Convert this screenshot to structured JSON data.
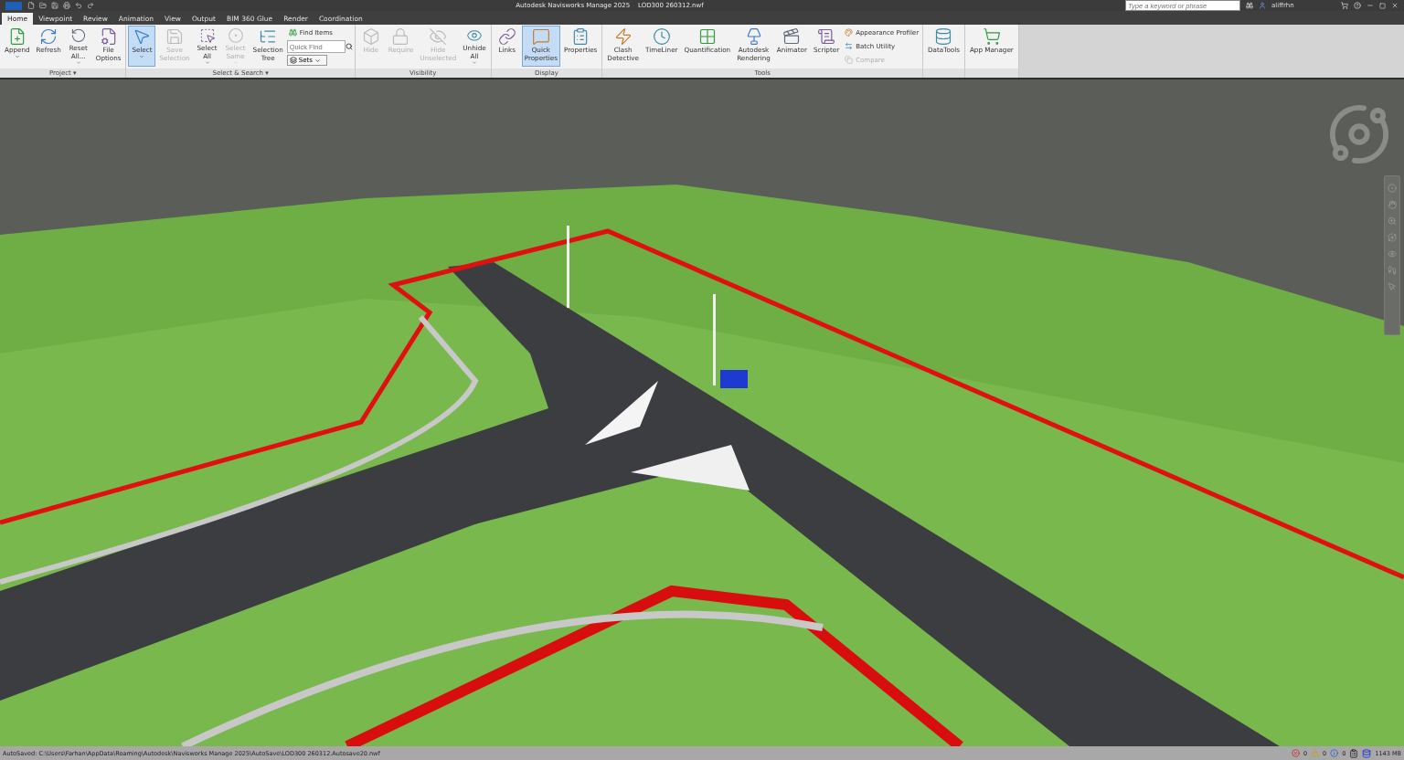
{
  "title_bar": {
    "app": "Autodesk Navisworks Manage 2025",
    "file": "LOD300 260312.nwf",
    "search_placeholder": "Type a keyword or phrase",
    "user": "aliffrhn"
  },
  "tabs": [
    {
      "label": "Home",
      "selected": true
    },
    {
      "label": "Viewpoint",
      "selected": false
    },
    {
      "label": "Review",
      "selected": false
    },
    {
      "label": "Animation",
      "selected": false
    },
    {
      "label": "View",
      "selected": false
    },
    {
      "label": "Output",
      "selected": false
    },
    {
      "label": "BIM 360 Glue",
      "selected": false
    },
    {
      "label": "Render",
      "selected": false
    },
    {
      "label": "Coordination",
      "selected": false
    }
  ],
  "panels": [
    {
      "title": "Project ▾",
      "items": [
        {
          "kind": "large",
          "label": "Append",
          "disabled": false,
          "selected": false,
          "has_menu": true
        },
        {
          "kind": "large",
          "label": "Refresh",
          "disabled": false,
          "selected": false,
          "has_menu": false
        },
        {
          "kind": "large",
          "label": "Reset\nAll...",
          "disabled": false,
          "selected": false,
          "has_menu": true
        },
        {
          "kind": "large",
          "label": "File\nOptions",
          "disabled": false,
          "selected": false,
          "has_menu": false
        }
      ]
    },
    {
      "title": "Select & Search ▾",
      "items": [
        {
          "kind": "large",
          "label": "Select",
          "disabled": false,
          "selected": true,
          "has_menu": true
        },
        {
          "kind": "large",
          "label": "Save\nSelection",
          "disabled": true,
          "selected": false,
          "has_menu": false
        },
        {
          "kind": "large",
          "label": "Select\nAll",
          "disabled": false,
          "selected": false,
          "has_menu": true
        },
        {
          "kind": "large",
          "label": "Select\nSame",
          "disabled": true,
          "selected": false,
          "has_menu": true
        },
        {
          "kind": "large",
          "label": "Selection\nTree",
          "disabled": false,
          "selected": false,
          "has_menu": false
        },
        {
          "kind": "small",
          "label": "Find Items",
          "disabled": false
        },
        {
          "kind": "field",
          "placeholder": "Quick Find"
        },
        {
          "kind": "dropdown",
          "label": "Sets"
        }
      ]
    },
    {
      "title": "Visibility",
      "items": [
        {
          "kind": "large",
          "label": "Hide",
          "disabled": true,
          "selected": false,
          "has_menu": false
        },
        {
          "kind": "large",
          "label": "Require",
          "disabled": true,
          "selected": false,
          "has_menu": false
        },
        {
          "kind": "large",
          "label": "Hide\nUnselected",
          "disabled": true,
          "selected": false,
          "has_menu": false
        },
        {
          "kind": "large",
          "label": "Unhide\nAll",
          "disabled": false,
          "selected": false,
          "has_menu": true
        }
      ]
    },
    {
      "title": "Display",
      "items": [
        {
          "kind": "large",
          "label": "Links",
          "disabled": false,
          "selected": false,
          "has_menu": false
        },
        {
          "kind": "large",
          "label": "Quick\nProperties",
          "disabled": false,
          "selected": true,
          "has_menu": false
        },
        {
          "kind": "large",
          "label": "Properties",
          "disabled": false,
          "selected": false,
          "has_menu": false
        }
      ]
    },
    {
      "title": "Tools",
      "items": [
        {
          "kind": "large",
          "label": "Clash\nDetective",
          "disabled": false,
          "selected": false,
          "has_menu": false
        },
        {
          "kind": "large",
          "label": "TimeLiner",
          "disabled": false,
          "selected": false,
          "has_menu": false
        },
        {
          "kind": "large",
          "label": "Quantification",
          "disabled": false,
          "selected": false,
          "has_menu": false
        },
        {
          "kind": "large",
          "label": "Autodesk\nRendering",
          "disabled": false,
          "selected": false,
          "has_menu": false
        },
        {
          "kind": "large",
          "label": "Animator",
          "disabled": false,
          "selected": false,
          "has_menu": false
        },
        {
          "kind": "large",
          "label": "Scripter",
          "disabled": false,
          "selected": false,
          "has_menu": false
        },
        {
          "kind": "small",
          "label": "Appearance Profiler",
          "disabled": false
        },
        {
          "kind": "small",
          "label": "Batch Utility",
          "disabled": false
        },
        {
          "kind": "small",
          "label": "Compare",
          "disabled": true
        }
      ]
    },
    {
      "items": [
        {
          "kind": "large",
          "label": "DataTools",
          "disabled": false,
          "selected": false,
          "has_menu": false
        }
      ]
    },
    {
      "items": [
        {
          "kind": "large",
          "label": "App Manager",
          "disabled": false,
          "selected": false,
          "has_menu": false
        }
      ]
    }
  ],
  "status_bar": {
    "message": "AutoSaved: C:\\Users\\Farhan\\AppData\\Roaming\\Autodesk\\Navisworks Manage 2025\\AutoSave\\LOD300 260312.Autosave20.nwf",
    "errors": "0",
    "warnings": "0",
    "infos": "0",
    "memory": "1143 MB"
  }
}
